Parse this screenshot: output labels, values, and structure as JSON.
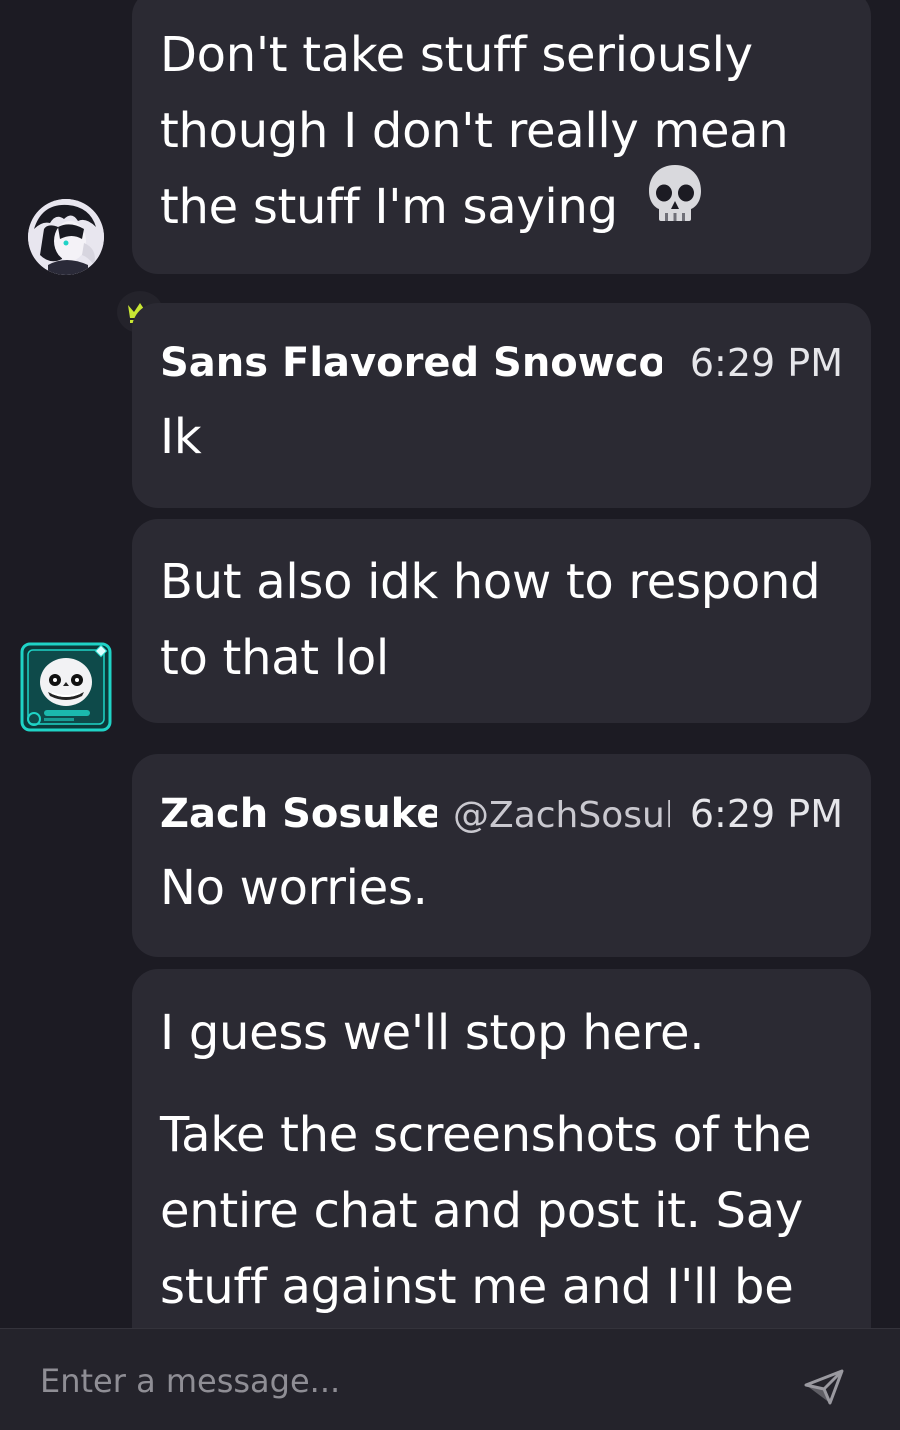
{
  "messages": [
    {
      "lines": [
        "Don't take stuff seriously",
        "though I don't really mean",
        "the stuff I'm saying"
      ],
      "emoji": "skull-emoji"
    },
    {
      "sender": "Sans Flavored Snowcor",
      "time": "6:29 PM",
      "lines": [
        "Ik"
      ]
    },
    {
      "lines": [
        "But also idk how to respond",
        "to that lol"
      ]
    },
    {
      "sender": "Zach Sosuke",
      "handle": "@ZachSosul",
      "time": "6:29 PM",
      "lines": [
        "No worries."
      ]
    },
    {
      "paragraph1": "I guess we'll stop here.",
      "lines": [
        "Take the screenshots of the",
        "entire chat and post it. Say",
        "stuff against me and I'll be"
      ]
    }
  ],
  "composer": {
    "placeholder": "Enter a message..."
  },
  "colors": {
    "background": "#1c1b23",
    "bubble": "#2b2a33",
    "crown": "#c8e633",
    "cyan_frame": "#1fd3c6"
  },
  "icons": {
    "crown": "crown-icon",
    "send": "send-icon",
    "skull": "skull-emoji"
  }
}
